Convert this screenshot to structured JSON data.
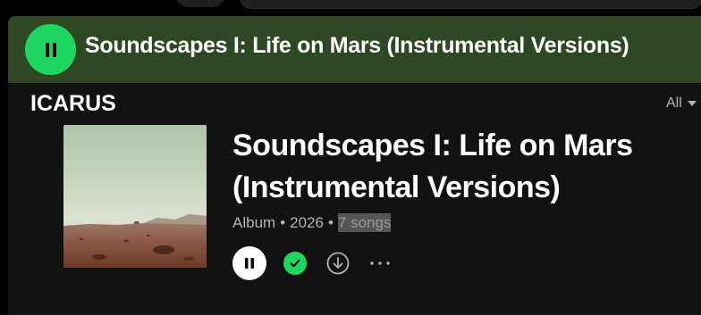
{
  "sticky_header": {
    "title": "Soundscapes I: Life on Mars (Instrumental Versions)",
    "play_button_icon": "pause-icon",
    "background_color": "#2e4823",
    "accent_color": "#1ed760"
  },
  "section": {
    "title": "ICARUS",
    "filter_label": "All",
    "filter_icon": "caret-down-icon"
  },
  "album": {
    "title_line1": "Soundscapes I: Life on Mars",
    "title_line2": "(Instrumental Versions)",
    "type": "Album",
    "separator": "•",
    "year": "2026",
    "song_count": "7 songs",
    "controls": {
      "play_icon": "pause-icon",
      "saved_icon": "check-circle-icon",
      "download_icon": "download-icon",
      "more_icon": "more-icon"
    }
  }
}
